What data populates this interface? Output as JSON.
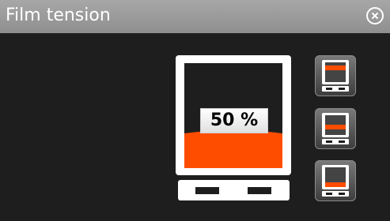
{
  "window": {
    "title": "Film tension",
    "close_icon": "close-circle-icon"
  },
  "gauge": {
    "value_label": "50 %",
    "value": 0.5,
    "fill_fraction": 0.27,
    "fill_color": "#ff4d00"
  },
  "presets": [
    {
      "name": "preset-high",
      "icon": "tension-high-icon",
      "fill_fraction": 0.85
    },
    {
      "name": "preset-medium",
      "icon": "tension-medium-icon",
      "fill_fraction": 0.5
    },
    {
      "name": "preset-low",
      "icon": "tension-low-icon",
      "fill_fraction": 0.22
    }
  ],
  "colors": {
    "accent": "#ff4d00",
    "titlebar": "#9b9b9b",
    "background": "#1e1e1e"
  }
}
